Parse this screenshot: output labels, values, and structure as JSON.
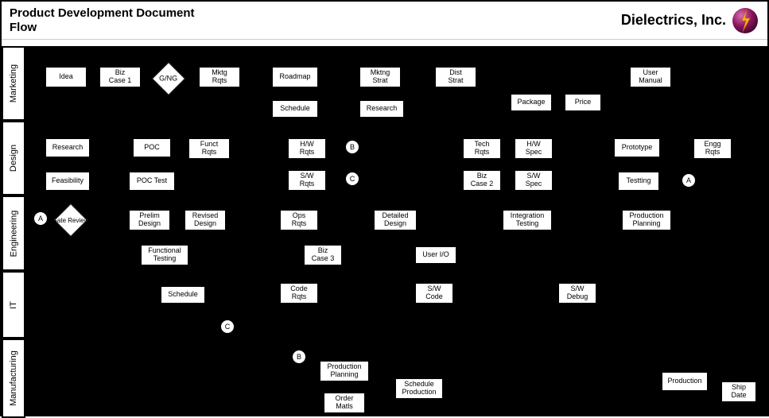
{
  "header": {
    "title_line1": "Product Development Document",
    "title_line2": "Flow",
    "company": "Dielectrics, Inc."
  },
  "lanes": {
    "marketing": "Marketing",
    "design": "Design",
    "engineering": "Engineering",
    "it": "IT",
    "manufacturing": "Manufacturing"
  },
  "nodes": {
    "idea": "Idea",
    "biz_case_1": "Biz\nCase 1",
    "g_ng": "G/NG",
    "mktg_rqts": "Mktg\nRqts",
    "roadmap": "Roadmap",
    "mktng_strat": "Mktng\nStrat",
    "dist_strat": "Dist\nStrat",
    "user_manual": "User\nManual",
    "schedule_m": "Schedule",
    "research_m": "Research",
    "package": "Package",
    "price": "Price",
    "research_d": "Research",
    "poc": "POC",
    "funct_rqts": "Funct\nRqts",
    "hw_rqts": "H/W\nRqts",
    "b1": "B",
    "tech_rqts": "Tech\nRqts",
    "hw_spec": "H/W\nSpec",
    "prototype": "Prototype",
    "engg_rqts": "Engg\nRqts",
    "feasibility": "Feasibility",
    "poc_test": "POC Test",
    "sw_rqts": "S/W\nRqts",
    "c1": "C",
    "biz_case_2": "Biz\nCase 2",
    "sw_spec": "S/W\nSpec",
    "testing_d": "Testting",
    "a1": "A",
    "a2": "A",
    "gate_review": "Gate\nReview",
    "prelim_design": "Prelim\nDesign",
    "revised_design": "Revised\nDesign",
    "ops_rqts": "Ops\nRqts",
    "detailed_design": "Detailed\nDesign",
    "integration_testing": "Integration\nTesting",
    "production_planning_e": "Production\nPlanning",
    "functional_testing": "Functional\nTesting",
    "biz_case_3": "Biz\nCase 3",
    "user_io": "User I/O",
    "schedule_it": "Schedule",
    "code_rqts": "Code\nRqts",
    "sw_code": "S/W\nCode",
    "sw_debug": "S/W\nDebug",
    "c2": "C",
    "b2": "B",
    "production_planning_m": "Production\nPlanning",
    "order_matls": "Order\nMatls",
    "schedule_production": "Schedule\nProduction",
    "production": "Production",
    "ship_date": "Ship\nDate"
  }
}
